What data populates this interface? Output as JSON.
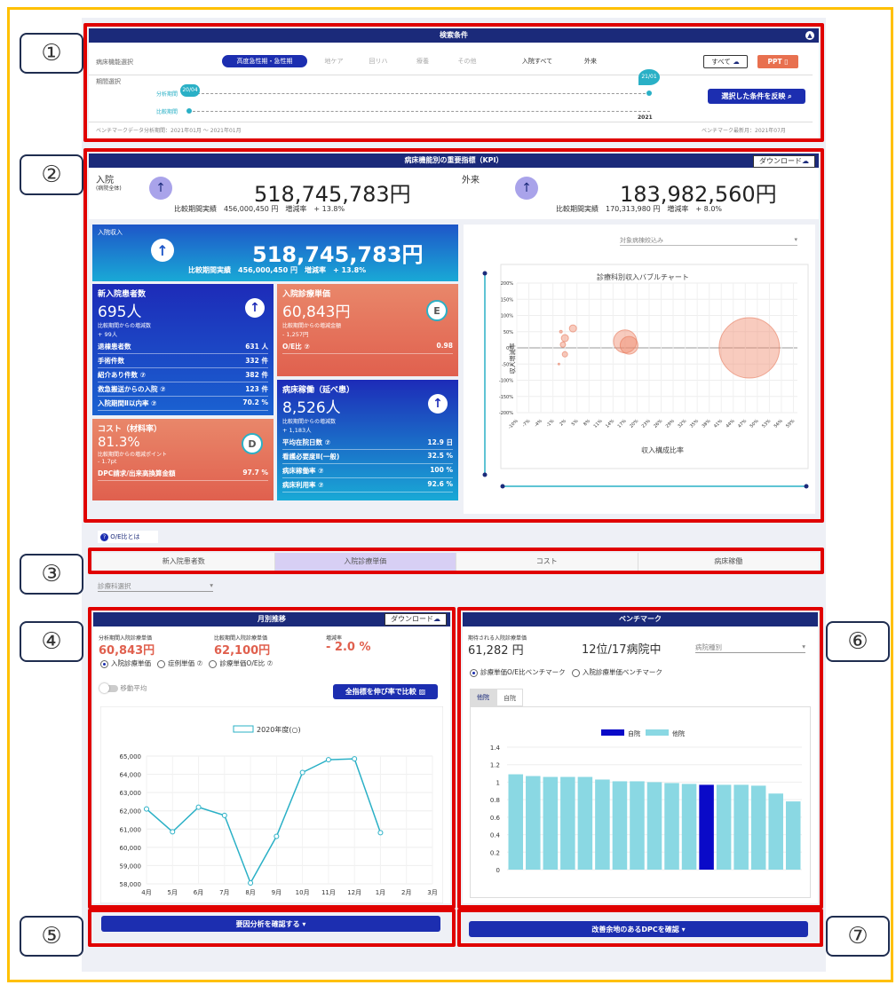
{
  "markers": {
    "m1": "①",
    "m2": "②",
    "m3": "③",
    "m4": "④",
    "m5": "⑤",
    "m6": "⑥",
    "m7": "⑦"
  },
  "search": {
    "title": "検索条件",
    "ward_label": "病床機能選択",
    "filters": [
      "高度急性期・急性期",
      "地ケア",
      "回リハ",
      "療養",
      "その他",
      "入院すべて",
      "外来"
    ],
    "period_label": "期間選択",
    "analysis_label": "分析期間",
    "compare_label": "比較期間",
    "pin_start": "20/04",
    "pin_end": "21/01",
    "year_label": "2021",
    "btn_all": "すべて",
    "btn_ppt": "PPT",
    "btn_apply": "選択した条件を反映",
    "bench_period": "ベンチマークデータ分析期間：2021年01月 ～ 2021年01月",
    "bench_update": "ベンチマーク最新月：2021年07月"
  },
  "kpi": {
    "title": "病床機能別の重要指標（KPI）",
    "download": "ダウンロード",
    "inpatient_label": "入院",
    "inpatient_sub": "(病院全体)",
    "inpatient_value": "518,745,783円",
    "inpatient_compare": "比較期間実績　456,000,450 円　増減率　+ 13.8%",
    "outpatient_label": "外来",
    "outpatient_value": "183,982,560円",
    "outpatient_compare": "比較期間実績　170,313,980 円　増減率　+ 8.0%",
    "revenue": {
      "label": "入院収入",
      "value": "518,745,783円",
      "compare": "比較期間実績　456,000,450 円　増減率　+ 13.8%"
    },
    "newpatients": {
      "title": "新入院患者数",
      "value": "695人",
      "sub": "比較期間からの増減数",
      "delta": "+ 99人",
      "rows": [
        [
          "退棟患者数",
          "631 人"
        ],
        [
          "手術件数",
          "332 件"
        ],
        [
          "紹介あり件数 ⑦",
          "382 件"
        ],
        [
          "救急搬送からの入院 ⑦",
          "123 件"
        ],
        [
          "入院期間Ⅱ以内率 ⑦",
          "70.2 %"
        ]
      ]
    },
    "unitprice": {
      "title": "入院診療単価",
      "value": "60,843円",
      "sub": "比較期間からの増減金額",
      "delta": "- 1,257円",
      "rows": [
        [
          "O/E比 ⑦",
          "0.98"
        ]
      ],
      "badge": "E"
    },
    "cost": {
      "title": "コスト（材料率）",
      "value": "81.3%",
      "sub": "比較期間からの増減ポイント",
      "delta": "- 1.7pt",
      "rows": [
        [
          "DPC請求/出来高換算金額",
          "97.7 %"
        ]
      ],
      "badge": "D"
    },
    "beds": {
      "title": "病床稼働（延べ患）",
      "value": "8,526人",
      "sub": "比較期間からの増減数",
      "delta": "+ 1,183人",
      "rows": [
        [
          "平均在院日数 ⑦",
          "12.9 日"
        ],
        [
          "看護必要度Ⅱ(一般)",
          "32.5 %"
        ],
        [
          "病床稼働率 ⑦",
          "100 %"
        ],
        [
          "病床利用率 ⑦",
          "92.6 %"
        ]
      ]
    },
    "bubble": {
      "dropdown": "対象病棟絞込み",
      "title": "診療科別収入バブルチャート",
      "xlabel": "収入構成比率",
      "ylabel": "収入増減率",
      "yticks": [
        "200%",
        "150%",
        "100%",
        "50%",
        "0%",
        "-50%",
        "-100%",
        "-150%",
        "-200%"
      ],
      "xticks": [
        "-10%",
        "-7%",
        "-4%",
        "-1%",
        "2%",
        "5%",
        "8%",
        "11%",
        "14%",
        "17%",
        "20%",
        "23%",
        "26%",
        "29%",
        "32%",
        "35%",
        "38%",
        "41%",
        "44%",
        "47%",
        "50%",
        "53%",
        "56%",
        "59%"
      ]
    }
  },
  "oe_link": "O/E比とは",
  "tabs": [
    "新入院患者数",
    "入院診療単価",
    "コスト",
    "病床稼働"
  ],
  "dept_select": "診療科選択",
  "monthly": {
    "title": "月別推移",
    "download": "ダウンロード",
    "label1": "分析期間入院診療単価",
    "value1": "60,843円",
    "label2": "比較期間入院診療単価",
    "value2": "62,100円",
    "label3": "増減率",
    "value3": "- 2.0 %",
    "radios": [
      "入院診療単価",
      "症例単価 ⑦",
      "診療単価O/E比 ⑦"
    ],
    "toggle": "移動平均",
    "compare_btn": "全指標を伸び率で比較",
    "legend": "2020年度(○)",
    "factor_btn": "要因分析を確認する"
  },
  "bench": {
    "title": "ベンチマーク",
    "label": "期待される入院診療単価",
    "value": "61,282 円",
    "rank": "12位/17病院中",
    "dropdown": "病院種別",
    "radios": [
      "診療単価O/E比ベンチマーク",
      "入院診療単価ベンチマーク"
    ],
    "subtabs": [
      "他院",
      "自院"
    ],
    "legend_self": "自院",
    "legend_other": "他院",
    "dpc_btn": "改善余地のあるDPCを確認"
  },
  "chart_data": [
    {
      "type": "line",
      "title": "",
      "legend": "2020年度(○)",
      "categories": [
        "4月",
        "5月",
        "6月",
        "7月",
        "8月",
        "9月",
        "10月",
        "11月",
        "12月",
        "1月",
        "2月",
        "3月"
      ],
      "values": [
        62100,
        60850,
        62200,
        61750,
        58050,
        60600,
        64100,
        64800,
        64850,
        60800,
        null,
        null
      ],
      "ylim": [
        58000,
        65000
      ],
      "yticks": [
        "58,000",
        "59,000",
        "60,000",
        "61,000",
        "62,000",
        "63,000",
        "64,000",
        "65,000"
      ]
    },
    {
      "type": "bar",
      "title": "",
      "series": [
        {
          "name": "他院",
          "values": [
            1.09,
            1.07,
            1.06,
            1.06,
            1.06,
            1.03,
            1.01,
            1.01,
            1.0,
            0.99,
            0.98,
            0,
            0.97,
            0.97,
            0.96,
            0.87,
            0.78
          ]
        },
        {
          "name": "自院",
          "values": [
            0,
            0,
            0,
            0,
            0,
            0,
            0,
            0,
            0,
            0,
            0,
            0.97,
            0,
            0,
            0,
            0,
            0
          ]
        }
      ],
      "ylim": [
        0,
        1.4
      ],
      "yticks": [
        "0",
        "0.2",
        "0.4",
        "0.6",
        "0.8",
        "1",
        "1.2",
        "1.4"
      ],
      "colors": {
        "self": "#0a0ac8",
        "other": "#8ad8e3"
      }
    },
    {
      "type": "scatter",
      "title": "診療科別収入バブルチャート",
      "xlabel": "収入構成比率",
      "ylabel": "収入増減率",
      "points": [
        {
          "x": 1,
          "y": 50
        },
        {
          "x": 4,
          "y": 60
        },
        {
          "x": 2,
          "y": 30
        },
        {
          "x": 1.5,
          "y": 10
        },
        {
          "x": 2,
          "y": -20
        },
        {
          "x": 0.5,
          "y": -50
        },
        {
          "x": 17,
          "y": 20
        },
        {
          "x": 18,
          "y": 8
        },
        {
          "x": 48,
          "y": 0
        }
      ],
      "ylim": [
        -200,
        200
      ]
    }
  ]
}
